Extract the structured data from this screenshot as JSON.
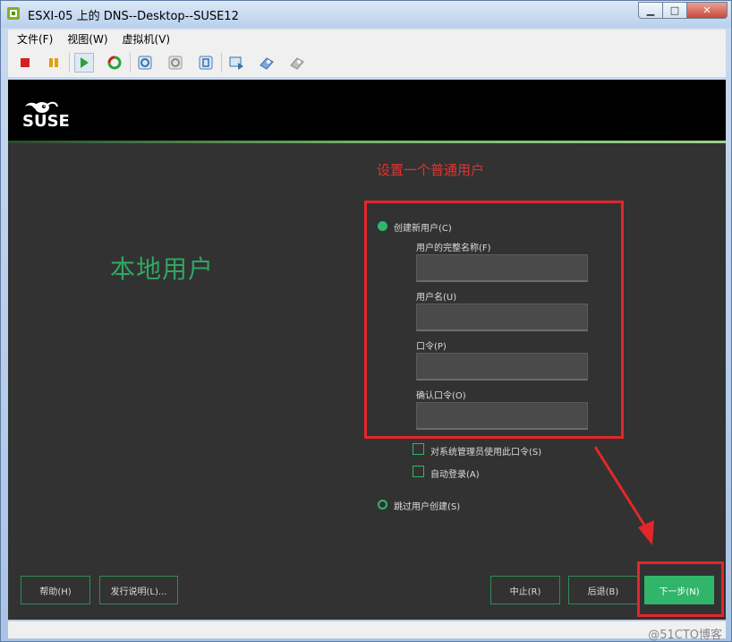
{
  "window": {
    "title": "ESXI-05 上的 DNS--Desktop--SUSE12"
  },
  "menu": [
    "文件(F)",
    "视图(W)",
    "虚拟机(V)"
  ],
  "toolbar": {
    "icons": [
      "stop-icon",
      "pause-icon",
      "play-icon",
      "reset-icon",
      "snapshot-icon",
      "revert-snapshot-icon",
      "manage-snapshots-icon",
      "console-icon",
      "vm-settings-icon",
      "connect-devices-icon"
    ]
  },
  "installer": {
    "brand": "SUSE",
    "annotation": "设置一个普通用户",
    "heading": "本地用户",
    "create_user_option": "创建新用户(C)",
    "full_name_label": "用户的完整名称(F)",
    "username_label": "用户名(U)",
    "password_label": "口令(P)",
    "confirm_password_label": "确认口令(O)",
    "admin_password_checkbox": "对系统管理员使用此口令(S)",
    "autologin_checkbox": "自动登录(A)",
    "skip_user_option": "跳过用户创建(S)",
    "buttons": {
      "help": "帮助(H)",
      "release_notes": "发行说明(L)...",
      "abort": "中止(R)",
      "back": "后退(B)",
      "next": "下一步(N)"
    },
    "colors": {
      "accent": "#31b56a",
      "annotation": "#e3262b"
    }
  },
  "watermark": "@51CTO博客"
}
